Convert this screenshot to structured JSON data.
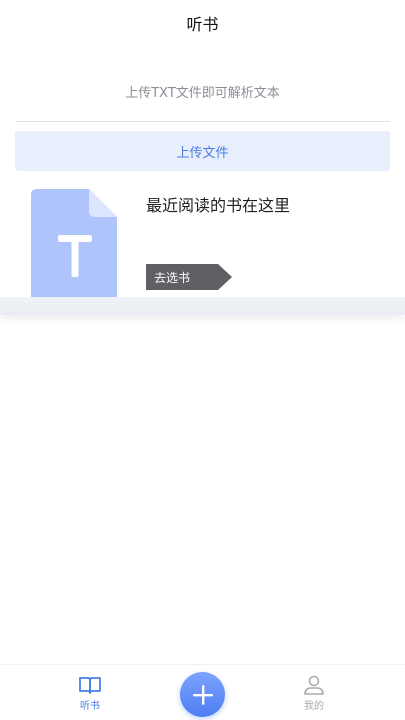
{
  "header": {
    "title": "听书"
  },
  "upload": {
    "hint": "上传TXT文件即可解析文本",
    "button_label": "上传文件"
  },
  "recent": {
    "message": "最近阅读的书在这里",
    "action_label": "去选书"
  },
  "tabbar": {
    "items": [
      {
        "label": "听书",
        "icon": "book-icon",
        "active": true
      },
      {
        "label": "我的",
        "icon": "person-icon",
        "active": false
      }
    ],
    "center_icon": "plus-icon"
  },
  "colors": {
    "accent": "#4a7de3",
    "upload_bg": "#e8eefb",
    "file_icon": "#aec4fb",
    "action_bg": "#5f6063"
  }
}
